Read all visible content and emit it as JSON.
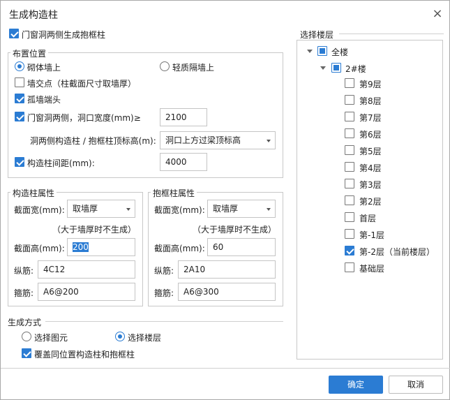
{
  "dialog": {
    "title": "生成构造柱",
    "close_icon": "×"
  },
  "gen_embrace": {
    "label": "门窗洞两侧生成抱框柱",
    "checked": true
  },
  "layout": {
    "legend": "布置位置",
    "radio_masonry": "砌体墙上",
    "radio_light": "轻质隔墙上",
    "wall_intersection": "墙交点（柱截面尺寸取墙厚）",
    "wall_end": "孤墙端头",
    "door_sides": "门窗洞两侧，洞口宽度(mm)≥",
    "door_width_value": "2100",
    "top_elev_label": "洞两侧构造柱 / 抱框柱顶标高(m):",
    "top_elev_value": "洞口上方过梁顶标高",
    "spacing_label": "构造柱间距(mm):",
    "spacing_value": "4000"
  },
  "column": {
    "legend": "构造柱属性",
    "width_label": "截面宽(mm):",
    "width_value": "取墙厚",
    "note": "（大于墙厚时不生成）",
    "height_label": "截面高(mm):",
    "height_value": "200",
    "long_rebar_label": "纵筋:",
    "long_rebar_value": "4C12",
    "stirrup_label": "箍筋:",
    "stirrup_value": "A6@200"
  },
  "embrace": {
    "legend": "抱框柱属性",
    "width_label": "截面宽(mm):",
    "width_value": "取墙厚",
    "note": "（大于墙厚时不生成）",
    "height_label": "截面高(mm):",
    "height_value": "60",
    "long_rebar_label": "纵筋:",
    "long_rebar_value": "2A10",
    "stirrup_label": "箍筋:",
    "stirrup_value": "A6@300"
  },
  "method": {
    "legend": "生成方式",
    "radio_element": "选择图元",
    "radio_floor": "选择楼层",
    "overwrite": "覆盖同位置构造柱和抱框柱"
  },
  "floors": {
    "legend": "选择楼层",
    "root": "全楼",
    "building": "2#楼",
    "items": [
      {
        "label": "第9层",
        "checked": false
      },
      {
        "label": "第8层",
        "checked": false
      },
      {
        "label": "第7层",
        "checked": false
      },
      {
        "label": "第6层",
        "checked": false
      },
      {
        "label": "第5层",
        "checked": false
      },
      {
        "label": "第4层",
        "checked": false
      },
      {
        "label": "第3层",
        "checked": false
      },
      {
        "label": "第2层",
        "checked": false
      },
      {
        "label": "首层",
        "checked": false
      },
      {
        "label": "第-1层",
        "checked": false
      },
      {
        "label": "第-2层（当前楼层）",
        "checked": true
      },
      {
        "label": "基础层",
        "checked": false
      }
    ]
  },
  "buttons": {
    "ok": "确定",
    "cancel": "取消"
  },
  "colors": {
    "accent": "#2b7cd3"
  }
}
